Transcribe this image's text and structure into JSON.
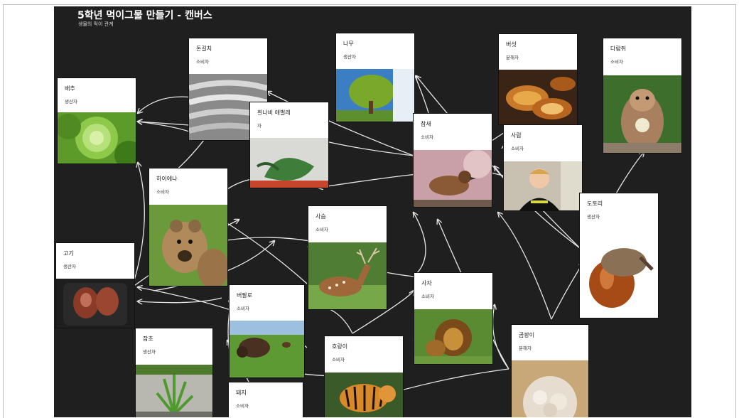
{
  "canvas": {
    "title": "5학년 먹이그물 만들기 - 캔버스",
    "subtitle": "생물의 먹이 관계"
  },
  "cards": {
    "cabbage": {
      "name": "배추",
      "role": "생산자"
    },
    "mushroom": {
      "name": "돈길치",
      "role": "소비자"
    },
    "butterfly": {
      "name": "흰나비 애벌레",
      "role": "자"
    },
    "tree": {
      "name": "나무",
      "role": "생산자"
    },
    "fungus": {
      "name": "버섯",
      "role": "분해자"
    },
    "chipmunk": {
      "name": "다람쥐",
      "role": "소비자"
    },
    "sparrow": {
      "name": "참새",
      "role": "소비자"
    },
    "person": {
      "name": "사람",
      "role": "소비자"
    },
    "hyena": {
      "name": "하이에나",
      "role": "소비자"
    },
    "deer": {
      "name": "사슴",
      "role": "소비자"
    },
    "acorn": {
      "name": "도토리",
      "role": "생산자"
    },
    "meat": {
      "name": "고기",
      "role": "생산자"
    },
    "lion": {
      "name": "사자",
      "role": "소비자"
    },
    "buffalo": {
      "name": "버팔로",
      "role": "소비자"
    },
    "grass": {
      "name": "잡초",
      "role": "생산자"
    },
    "tiger": {
      "name": "호랑이",
      "role": "소비자"
    },
    "mold": {
      "name": "곰팡이",
      "role": "분해자"
    },
    "pig": {
      "name": "돼지",
      "role": "소비자"
    }
  }
}
